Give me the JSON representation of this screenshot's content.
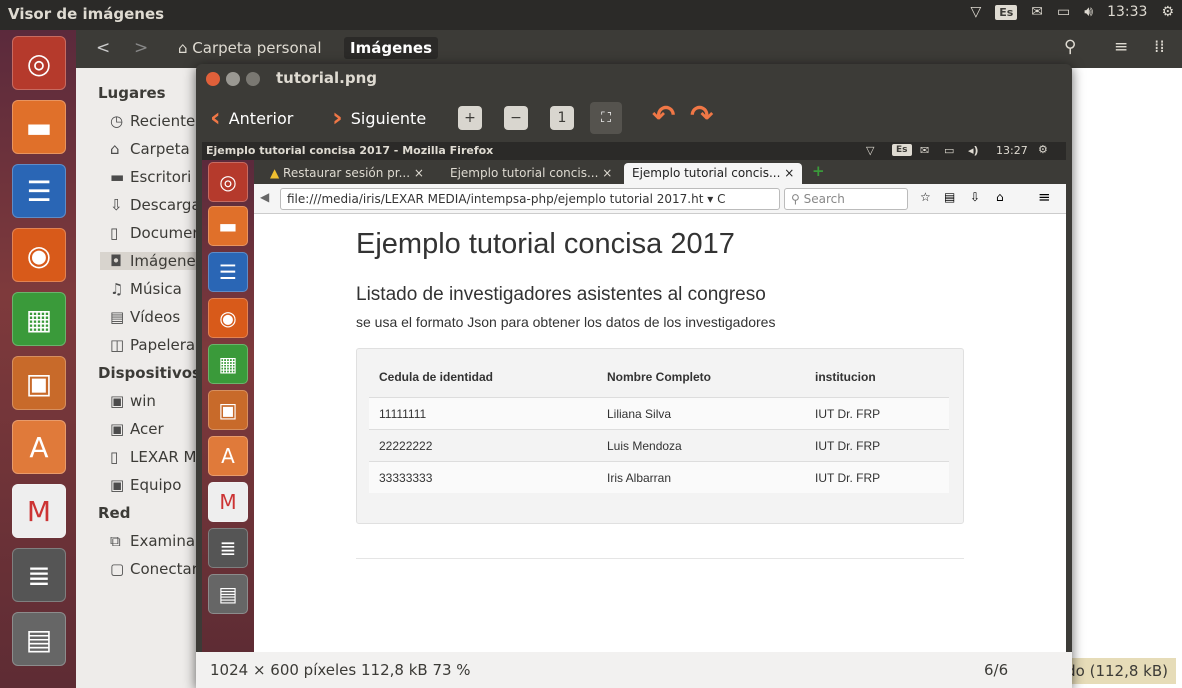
{
  "topbar": {
    "title": "Visor de imágenes",
    "kbd": "Es",
    "time": "13:33"
  },
  "nautilus": {
    "back": "<",
    "forward": ">",
    "crumb_home": "Carpeta personal",
    "crumb_current": "Imágenes",
    "places_header": "Lugares",
    "places": [
      "Reciente",
      "Carpeta",
      "Escritori",
      "Descarga",
      "Documen",
      "Imágene",
      "Música",
      "Vídeos",
      "Papelera"
    ],
    "devices_header": "Dispositivos",
    "devices": [
      "win",
      "Acer",
      "LEXAR M",
      "Equipo"
    ],
    "network_header": "Red",
    "network": [
      "Examina",
      "Conectar"
    ],
    "behind_status": "do (112,8 kB)"
  },
  "viewer": {
    "title": "tutorial.png",
    "prev": "Anterior",
    "next": "Siguiente",
    "status_info": "1024 × 600 píxeles  112,8 kB  73 %",
    "counter": "6/6"
  },
  "inner": {
    "window_title": "Ejemplo tutorial concisa 2017 - Mozilla Firefox",
    "kbd": "Es",
    "time": "13:27",
    "tabs": [
      "Restaurar sesión pr...",
      "Ejemplo tutorial concis...",
      "Ejemplo tutorial concis..."
    ],
    "url": "file:///media/iris/LEXAR MEDIA/intempsa-php/ejemplo tutorial 2017.ht",
    "search_placeholder": "Search",
    "page": {
      "heading": "Ejemplo tutorial concisa 2017",
      "subheading": "Listado de investigadores asistentes al congreso",
      "description": "se usa el formato Json para obtener los datos de los investigadores",
      "columns": [
        "Cedula de identidad",
        "Nombre Completo",
        "institucion"
      ],
      "rows": [
        [
          "11111111",
          "Liliana Silva",
          "IUT Dr. FRP"
        ],
        [
          "22222222",
          "Luis Mendoza",
          "IUT Dr. FRP"
        ],
        [
          "33333333",
          "Iris Albarran",
          "IUT Dr. FRP"
        ]
      ]
    }
  },
  "colors": {
    "accent": "#f07746",
    "panel": "#2b2a28",
    "launcher": "#7e3a3c"
  }
}
